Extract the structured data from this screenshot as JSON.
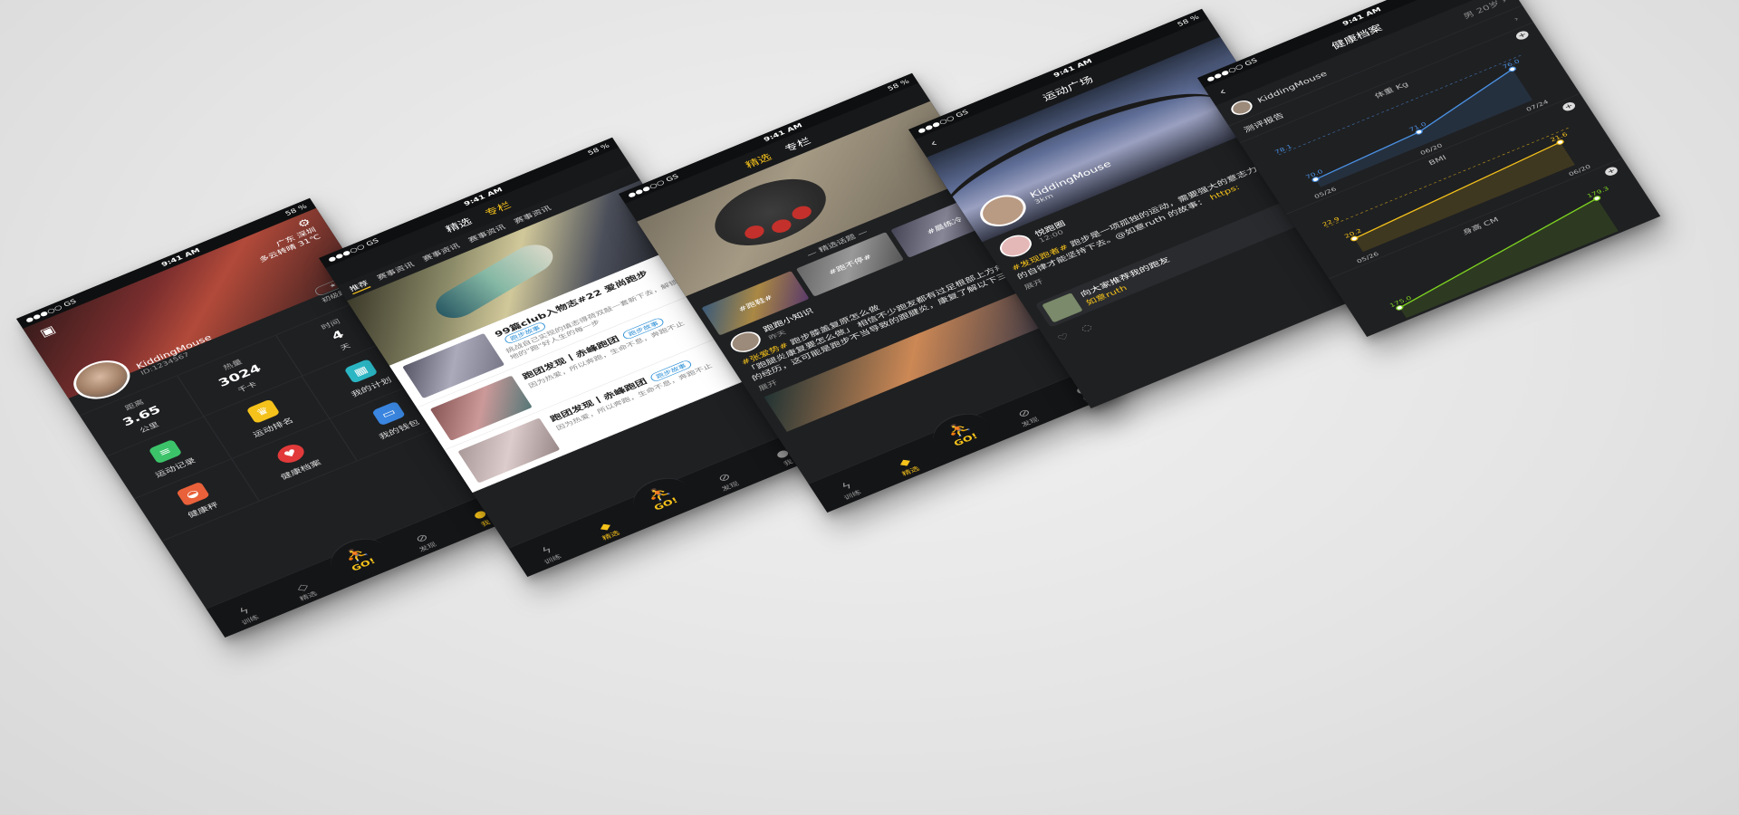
{
  "status": {
    "carrier": "●●●○○ GS",
    "time": "9:41 AM",
    "battery": "58 %"
  },
  "tabbar": {
    "train": "训练",
    "featured": "精选",
    "go": "GO!",
    "discover": "发现",
    "me": "我"
  },
  "phone1": {
    "location": "广东 深圳",
    "weather": "多云转晴 31℃",
    "user_name": "KiddingMouse",
    "user_id": "ID:1234567",
    "level": "初级跑者",
    "stats": [
      {
        "label": "距离",
        "value": "3.65",
        "unit": "公里"
      },
      {
        "label": "热量",
        "value": "3024",
        "unit": "千卡"
      },
      {
        "label": "时间",
        "value": "4",
        "unit": "天"
      }
    ],
    "grid": [
      {
        "label": "运动记录",
        "icon": "clipboard-icon",
        "color": "#3cc36a"
      },
      {
        "label": "运动排名",
        "icon": "trophy-icon",
        "color": "#f5c21b"
      },
      {
        "label": "我的计划",
        "icon": "calendar-icon",
        "color": "#2bb6c4"
      },
      {
        "label": "健康秤",
        "icon": "scale-icon",
        "color": "#e8613a"
      },
      {
        "label": "健康档案",
        "icon": "heart-icon",
        "color": "#e23a3a"
      },
      {
        "label": "我的钱包",
        "icon": "wallet-icon",
        "color": "#3a86e0"
      }
    ]
  },
  "phone2": {
    "nav": [
      "精选",
      "专栏"
    ],
    "tabs": [
      "推荐",
      "赛事资讯",
      "赛事资讯",
      "赛事资讯",
      "赛事资讯"
    ],
    "news": [
      {
        "title": "99篇club入物志#22 爱尚跑步",
        "desc": "挑战自己实现的填志得荷双敲一套新下去，解锁实地的\"跑\"好人生的每一步",
        "tag": "跑步故事"
      },
      {
        "title": "跑团发现丨赤峰跑团",
        "desc": "因为热爱，所以奔跑，生命不息，奔跑不止",
        "tag": "跑步故事"
      },
      {
        "title": "跑团发现丨赤峰跑团",
        "desc": "因为热爱，所以奔跑，生命不息，奔跑不止",
        "tag": "跑步故事"
      }
    ]
  },
  "phone3": {
    "nav": [
      "精选",
      "专栏"
    ],
    "section": "— 精选话题 —",
    "topics": [
      "#跑鞋#",
      "#跑不停#",
      "#晨练冷"
    ],
    "feed": {
      "name": "跑跑小知识",
      "sub": "昨天",
      "hashtag": "#张爱势#",
      "title": "跑步膝盖复原怎么做",
      "body": "「跑腿炎康复要怎么做」 相信不少跑友都有过足根部上方疼痛的经历，这可能是跑步不当导致的跟腱炎，康复了解以下三点…",
      "more": "展开"
    }
  },
  "phone4": {
    "title": "运动广场",
    "user": {
      "name": "KiddingMouse",
      "dist": "3km"
    },
    "post": {
      "name": "悦跑圈",
      "time": "12:00",
      "hashtag": "#发现跑者#",
      "body": "跑步是一项孤独的运动，需要强大的意志力和严格的自律才能坚持下去。@如意ruth 的故事：",
      "link": "https:",
      "more": "展开"
    },
    "share": {
      "text": "向大家推荐我的跑友",
      "name": "如意ruth"
    }
  },
  "phone5": {
    "title": "健康档案",
    "gender": "男",
    "age": "20岁",
    "user": "KiddingMouse",
    "report": "测评报告",
    "weight": {
      "title": "体重 Kg",
      "ref": "78.1"
    },
    "bmi": {
      "title": "BMI",
      "ref": "22.9"
    },
    "height": {
      "title": "身高 CM"
    }
  },
  "chart_data": [
    {
      "type": "line",
      "title": "体重 Kg",
      "categories": [
        "05/26",
        "06/20",
        "07/24"
      ],
      "values": [
        70.0,
        71.0,
        76.0
      ],
      "reference": 78.1
    },
    {
      "type": "line",
      "title": "BMI",
      "categories": [
        "05/26",
        "06/20"
      ],
      "values": [
        20.2,
        21.6
      ],
      "reference": 22.9
    },
    {
      "type": "line",
      "title": "身高 CM",
      "categories": [
        "05/26",
        "06/20"
      ],
      "values": [
        175.0,
        179.3
      ]
    }
  ]
}
